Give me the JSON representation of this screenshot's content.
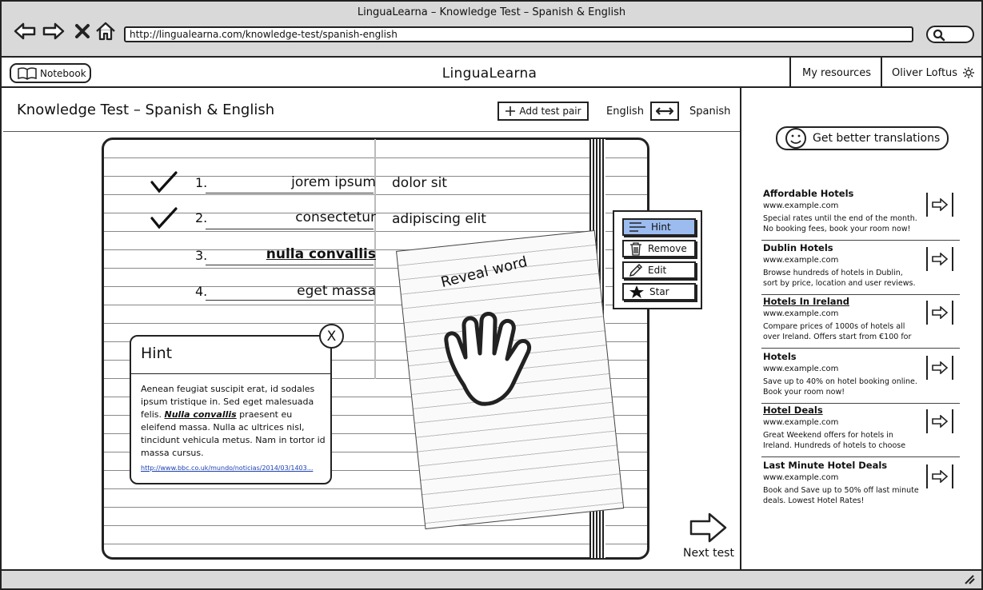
{
  "browser": {
    "title": "LinguaLearna – Knowledge Test – Spanish & English",
    "url": "http://lingualearna.com/knowledge-test/spanish-english"
  },
  "header": {
    "notebook_label": "Notebook",
    "app_title": "LinguaLearna",
    "my_resources": "My resources",
    "user_name": "Oliver Loftus"
  },
  "test": {
    "title": "Knowledge Test – Spanish & English",
    "add_pair_label": "Add test pair",
    "lang_left": "English",
    "lang_right": "Spanish",
    "rows": [
      {
        "num": "1.",
        "source": "jorem ipsum",
        "target": "dolor sit",
        "checked": true
      },
      {
        "num": "2.",
        "source": "consectetur",
        "target": "adipiscing elit",
        "checked": true
      },
      {
        "num": "3.",
        "source": "nulla convallis",
        "target": "",
        "checked": false
      },
      {
        "num": "4.",
        "source": "eget massa",
        "target": "",
        "checked": false
      }
    ],
    "reveal_label": "Reveal word",
    "next_label": "Next test"
  },
  "context_menu": {
    "hint": "Hint",
    "remove": "Remove",
    "edit": "Edit",
    "star": "Star"
  },
  "hint_popup": {
    "title": "Hint",
    "body_start": "Aenean feugiat suscipit erat, id sodales ipsum tristique in. Sed eget malesuada felis. ",
    "body_strong": "Nulla convallis",
    "body_end": " praesent eu eleifend massa. Nulla ac ultrices nisl, tincidunt vehicula metus. Nam in tortor id massa cursus.",
    "link": "http://www.bbc.co.uk/mundo/noticias/2014/03/1403...",
    "close": "X"
  },
  "sidebar": {
    "better_translations": "Get better translations",
    "ads": [
      {
        "title": "Affordable Hotels",
        "url": "www.example.com",
        "desc": "Special rates until the end of the month. No booking fees, book your room now!",
        "link": false
      },
      {
        "title": "Dublin Hotels",
        "url": "www.example.com",
        "desc": "Browse hundreds of hotels in Dublin, sort by price, location and user reviews.",
        "link": false
      },
      {
        "title": "Hotels In Ireland",
        "url": "www.example.com",
        "desc": "Compare prices of 1000s of hotels all over Ireland. Offers start from €100 for",
        "link": true
      },
      {
        "title": "Hotels",
        "url": "www.example.com",
        "desc": "Save up to 40% on hotel booking online. Book your room now!",
        "link": false
      },
      {
        "title": "Hotel Deals",
        "url": "www.example.com",
        "desc": "Great Weekend offers for hotels in Ireland. Hundreds of hotels to choose",
        "link": true
      },
      {
        "title": "Last Minute Hotel Deals",
        "url": "www.example.com",
        "desc": "Book and Save up to 50% off last minute deals. Lowest Hotel Rates!",
        "link": false
      }
    ]
  },
  "colors": {
    "chrome_gray": "#d9d9d9",
    "hint_highlight": "#9cbcf0",
    "link_blue": "#1a3fb0"
  },
  "icons": [
    "back-arrow-icon",
    "forward-arrow-icon",
    "close-x-icon",
    "home-icon",
    "search-icon",
    "book-icon",
    "gear-icon",
    "plus-icon",
    "swap-arrows-icon",
    "checkmark-icon",
    "hand-pointer-icon",
    "lines-icon",
    "trash-icon",
    "pencil-icon",
    "star-icon",
    "next-arrow-icon",
    "smiley-icon",
    "right-arrow-icon",
    "resize-grip-icon"
  ]
}
